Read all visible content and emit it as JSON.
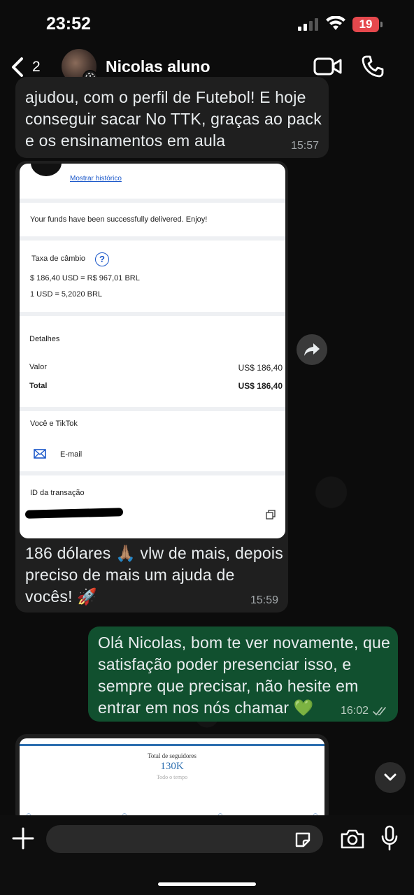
{
  "status_bar": {
    "time": "23:52",
    "battery": "19"
  },
  "header": {
    "back_count": "2",
    "contact_name": "Nicolas aluno"
  },
  "messages": [
    {
      "direction": "incoming",
      "text": "ajudou, com o perfil de Futebol! E hoje conseguir sacar No TTK, graças ao pack e os ensinamentos em aula",
      "time": "15:57"
    },
    {
      "direction": "incoming",
      "image_receipt": {
        "history_link": "Mostrar histórico",
        "success_message": "Your funds have been successfully delivered. Enjoy!",
        "exchange_label": "Taxa de câmbio",
        "exchange_line1": "$ 186,40 USD = R$ 967,01 BRL",
        "exchange_line2": "1 USD = 5,2020 BRL",
        "details_label": "Detalhes",
        "value_label": "Valor",
        "value_amount": "US$ 186,40",
        "total_label": "Total",
        "total_amount": "US$ 186,40",
        "you_and_label": "Você e TikTok",
        "email_label": "E-mail",
        "transaction_label": "ID da transação"
      },
      "text": "186 dólares 🙏🏽 vlw de mais, depois preciso de mais um ajuda de vocês! 🚀",
      "time": "15:59"
    },
    {
      "direction": "outgoing",
      "text": "Olá Nicolas, bom te ver novamente, que satisfação poder presenciar isso, e sempre que precisar, não hesite em entrar em nos nós chamar",
      "emoji": "💚",
      "time": "16:02",
      "status": "read"
    },
    {
      "direction": "incoming",
      "image_stats": {
        "title": "Total de seguidores",
        "value": "130K",
        "subtitle": "Todo o tempo"
      }
    }
  ],
  "input": {
    "placeholder": ""
  },
  "colors": {
    "incoming_bubble": "#1f1f1f",
    "outgoing_bubble": "#11502f",
    "accent_blue": "#1a57c9",
    "battery_red": "#e5484d"
  },
  "icons": [
    "back-chevron-icon",
    "video-call-icon",
    "phone-icon",
    "forward-icon",
    "chevron-down-icon",
    "plus-icon",
    "sticker-icon",
    "camera-icon",
    "microphone-icon",
    "read-receipt-icon",
    "help-icon",
    "mail-icon",
    "copy-icon"
  ]
}
